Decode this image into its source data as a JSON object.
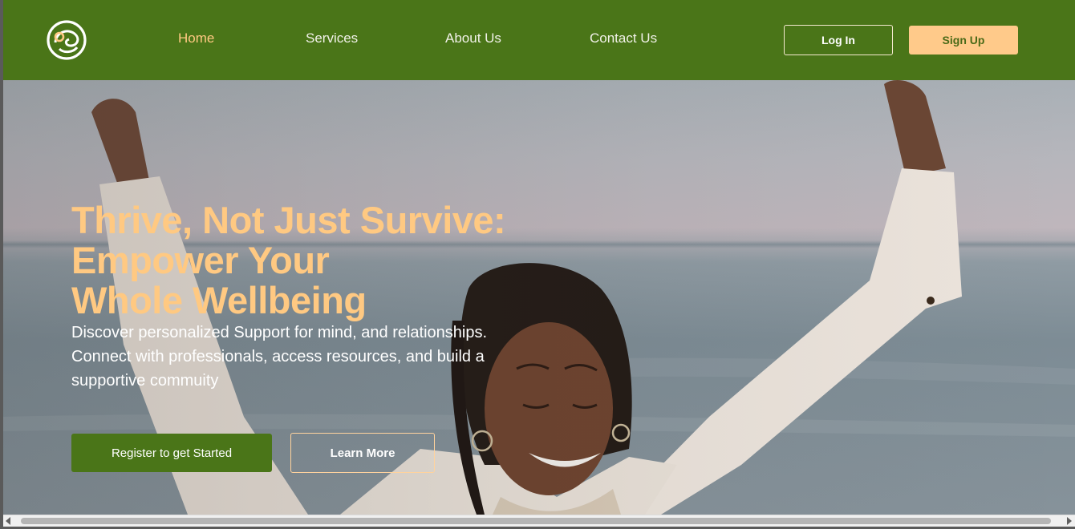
{
  "nav": {
    "links": [
      {
        "label": "Home",
        "active": true
      },
      {
        "label": "Services",
        "active": false
      },
      {
        "label": "About Us",
        "active": false
      },
      {
        "label": "Contact Us",
        "active": false
      }
    ],
    "login_label": "Log In",
    "signup_label": "Sign Up",
    "logo_icon": "brand-logo-icon"
  },
  "hero": {
    "headline_lines": [
      "Thrive, Not Just Survive:",
      "Empower Your",
      "Whole Wellbeing"
    ],
    "subtext": "Discover personalized Support for mind, and relationships. Connect with professionals, access resources, and build a supportive commuity",
    "register_label": "Register to get Started",
    "learn_more_label": "Learn More"
  },
  "colors": {
    "brand_green": "#4a7518",
    "accent_peach": "#ffc982",
    "signup_bg": "#ffca8a"
  }
}
